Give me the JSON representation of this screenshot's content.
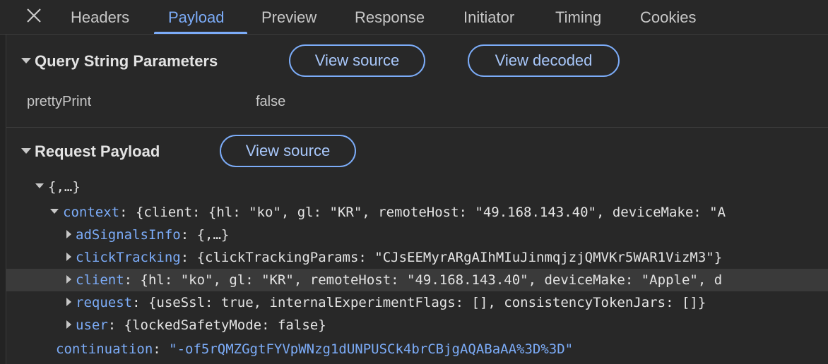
{
  "tabs": [
    "Headers",
    "Payload",
    "Preview",
    "Response",
    "Initiator",
    "Timing",
    "Cookies"
  ],
  "active_tab": "Payload",
  "query_section": {
    "title": "Query String Parameters",
    "view_source": "View source",
    "view_decoded": "View decoded",
    "params": [
      {
        "name": "prettyPrint",
        "value": "false"
      }
    ]
  },
  "payload_section": {
    "title": "Request Payload",
    "view_source": "View source"
  },
  "tree": {
    "root": "{,…}",
    "context_key": "context",
    "context_sep": ": ",
    "context_val": "{client: {hl: \"ko\", gl: \"KR\", remoteHost: \"49.168.143.40\", deviceMake: \"A",
    "children": [
      {
        "key": "adSignalsInfo",
        "val": "{,…}"
      },
      {
        "key": "clickTracking",
        "val": "{clickTrackingParams: \"CJsEEMyrARgAIhMIuJinmqjzjQMVKr5WAR1VizM3\"}"
      },
      {
        "key": "client",
        "val": "{hl: \"ko\", gl: \"KR\", remoteHost: \"49.168.143.40\", deviceMake: \"Apple\", d"
      },
      {
        "key": "request",
        "val": "{useSsl: true, internalExperimentFlags: [], consistencyTokenJars: []}"
      },
      {
        "key": "user",
        "val": "{lockedSafetyMode: false}"
      }
    ],
    "continuation_key": "continuation",
    "continuation_val": "\"-of5rQMZGgtFYVpWNzg1dUNPUSCk4brCBjgAQABaAA%3D%3D\""
  }
}
